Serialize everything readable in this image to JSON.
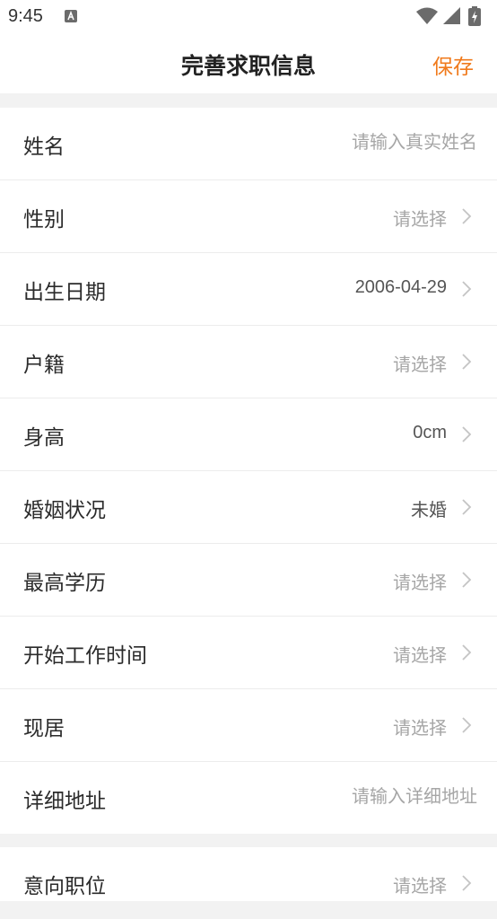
{
  "status_bar": {
    "time": "9:45",
    "icons": [
      "accessibility-a-icon",
      "wifi-icon",
      "signal-icon",
      "battery-charging-icon"
    ]
  },
  "header": {
    "title": "完善求职信息",
    "save_label": "保存"
  },
  "colors": {
    "accent": "#f07a1c",
    "placeholder": "#a6a6a6",
    "divider": "#ececec",
    "background": "#f2f2f2"
  },
  "form": {
    "name": {
      "label": "姓名",
      "placeholder": "请输入真实姓名"
    },
    "gender": {
      "label": "性别",
      "value": "请选择"
    },
    "birth_date": {
      "label": "出生日期",
      "value": "2006-04-29"
    },
    "hukou": {
      "label": "户籍",
      "value": "请选择"
    },
    "height": {
      "label": "身高",
      "value": "0cm"
    },
    "marital": {
      "label": "婚姻状况",
      "value": "未婚"
    },
    "education": {
      "label": "最高学历",
      "value": "请选择"
    },
    "work_start": {
      "label": "开始工作时间",
      "value": "请选择"
    },
    "residence": {
      "label": "现居",
      "value": "请选择"
    },
    "address": {
      "label": "详细地址",
      "placeholder": "请输入详细地址"
    },
    "desired_position": {
      "label": "意向职位",
      "value": "请选择"
    }
  }
}
